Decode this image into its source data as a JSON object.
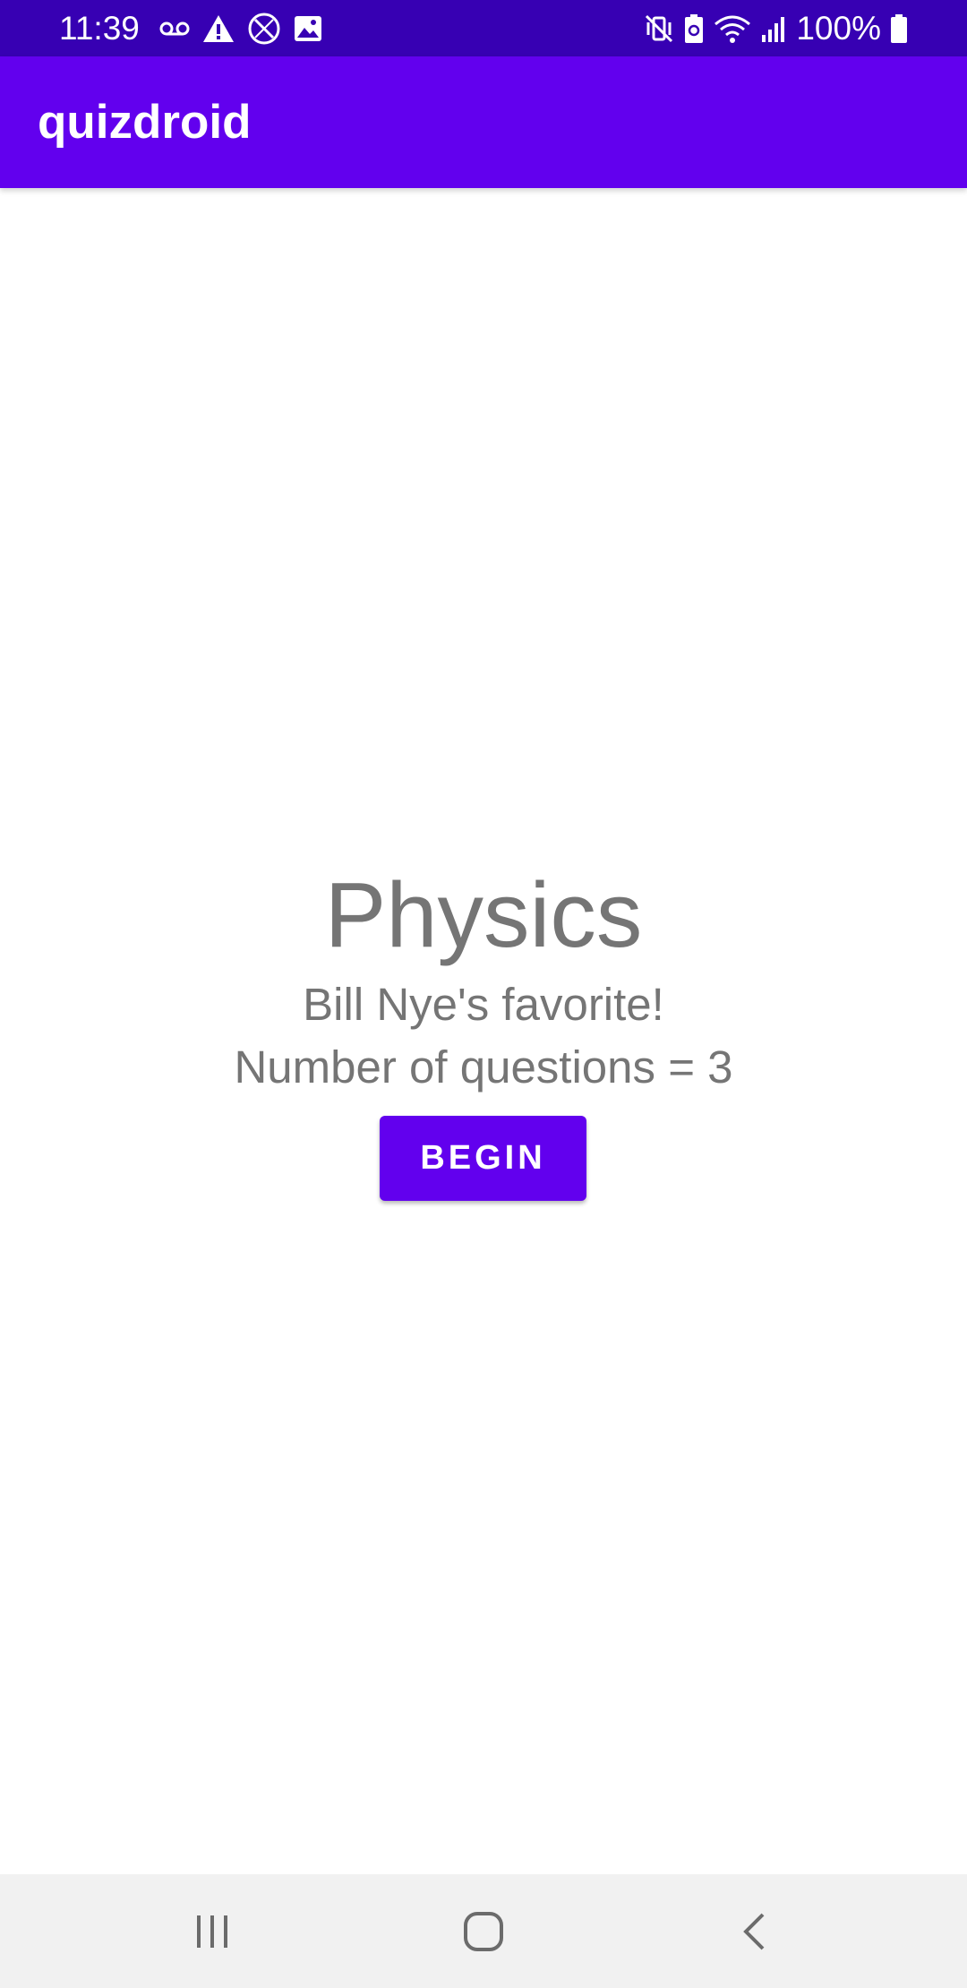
{
  "status_bar": {
    "time": "11:39",
    "battery_text": "100%",
    "left_icons": [
      "voicemail-icon",
      "warning-icon",
      "blocked-icon",
      "image-icon"
    ],
    "right_icons": [
      "vibrate-off-icon",
      "battery-saver-icon",
      "wifi-icon",
      "signal-icon",
      "battery-icon"
    ],
    "background_color": "#3700b3"
  },
  "app_bar": {
    "title": "quizdroid",
    "background_color": "#6200ee"
  },
  "quiz": {
    "title": "Physics",
    "description": "Bill Nye's favorite!",
    "question_count_text": "Number of questions = 3",
    "begin_label": "BEGIN"
  },
  "nav_bar": {
    "buttons": [
      "recent-apps-icon",
      "home-icon",
      "back-icon"
    ]
  }
}
